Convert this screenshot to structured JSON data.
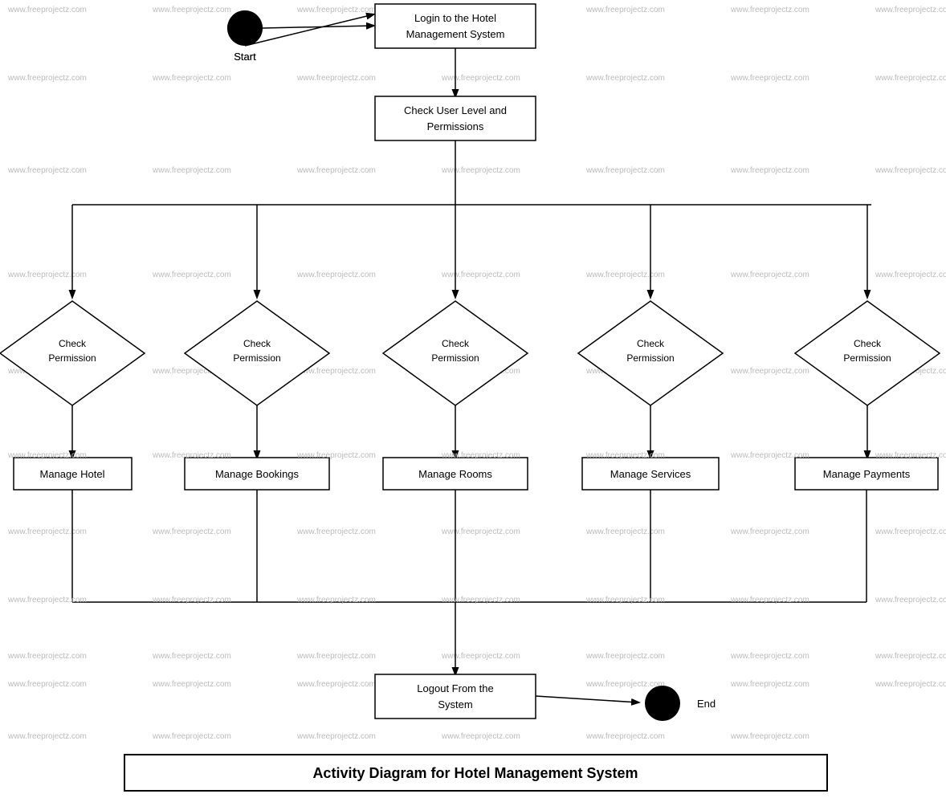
{
  "diagram": {
    "title": "Activity Diagram for Hotel Management System",
    "watermark": "www.freeprojectz.com",
    "nodes": {
      "start": {
        "label": "Start",
        "type": "circle"
      },
      "login": {
        "label": "Login to the Hotel\nManagement System",
        "type": "rect"
      },
      "checkPerms": {
        "label": "Check User Level and\nPermissions",
        "type": "rect"
      },
      "checkPerm1": {
        "label": "Check\nPermission",
        "type": "diamond"
      },
      "checkPerm2": {
        "label": "Check\nPermission",
        "type": "diamond"
      },
      "checkPerm3": {
        "label": "Check\nPermission",
        "type": "diamond"
      },
      "checkPerm4": {
        "label": "Check\nPermission",
        "type": "diamond"
      },
      "checkPerm5": {
        "label": "Check\nPermission",
        "type": "diamond"
      },
      "manageHotel": {
        "label": "Manage Hotel",
        "type": "rect"
      },
      "manageBookings": {
        "label": "Manage Bookings",
        "type": "rect"
      },
      "manageRooms": {
        "label": "Manage Rooms",
        "type": "rect"
      },
      "manageServices": {
        "label": "Manage Services",
        "type": "rect"
      },
      "managePayments": {
        "label": "Manage Payments",
        "type": "rect"
      },
      "logout": {
        "label": "Logout From the\nSystem",
        "type": "rect"
      },
      "end": {
        "label": "End",
        "type": "circle"
      }
    }
  }
}
